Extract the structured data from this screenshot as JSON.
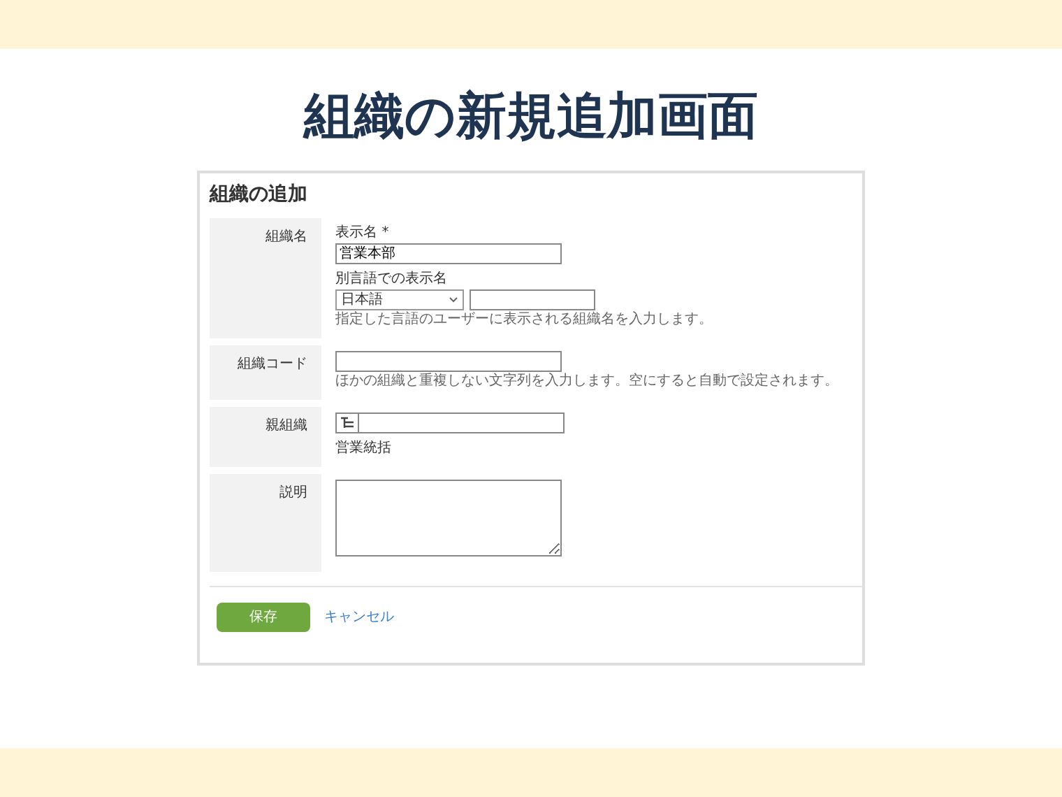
{
  "page_title": "組織の新規追加画面",
  "form": {
    "title": "組織の追加",
    "rows": [
      {
        "kind": "name",
        "label": "組織名",
        "display_name": {
          "label": "表示名",
          "required_mark": "*",
          "value": "営業本部"
        },
        "alt_name": {
          "label": "別言語での表示名",
          "language": "日本語",
          "hint": "指定した言語のユーザーに表示される組織名を入力します。"
        }
      },
      {
        "kind": "code",
        "label": "組織コード",
        "hint": "ほかの組織と重複しない文字列を入力します。空にすると自動で設定されます。"
      },
      {
        "kind": "parent",
        "label": "親組織",
        "note": "営業統括"
      },
      {
        "kind": "textarea",
        "label": "説明"
      }
    ],
    "save_button": "保存",
    "cancel_link": "キャンセル"
  }
}
